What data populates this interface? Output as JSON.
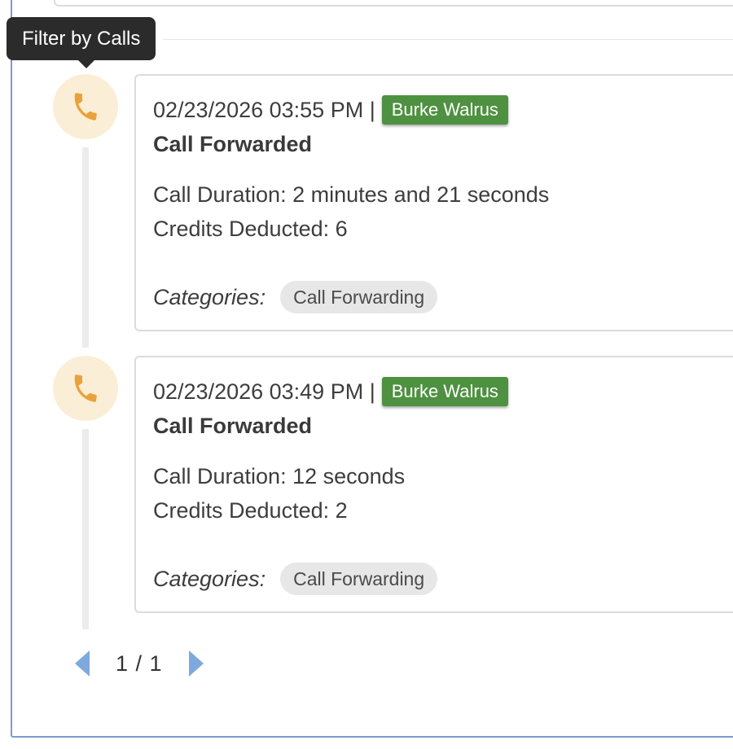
{
  "tooltip": {
    "text": "Filter by Calls"
  },
  "colors": {
    "agent_badge": "#4e9141",
    "icon_bg": "#fbeed6",
    "icon": "#e9a23b",
    "pager_arrow": "#7fa9dc"
  },
  "timeline": [
    {
      "icon": "phone-icon",
      "datetime": "02/23/2026 03:55 PM |",
      "agent": "Burke Walrus",
      "title": "Call Forwarded",
      "duration": "Call Duration: 2 minutes and 21 seconds",
      "credits": "Credits Deducted: 6",
      "categories_label": "Categories:",
      "category": "Call Forwarding"
    },
    {
      "icon": "phone-icon",
      "datetime": "02/23/2026 03:49 PM |",
      "agent": "Burke Walrus",
      "title": "Call Forwarded",
      "duration": "Call Duration: 12 seconds",
      "credits": "Credits Deducted: 2",
      "categories_label": "Categories:",
      "category": "Call Forwarding"
    }
  ],
  "pagination": {
    "text": "1 / 1",
    "current": 1,
    "total": 1
  }
}
